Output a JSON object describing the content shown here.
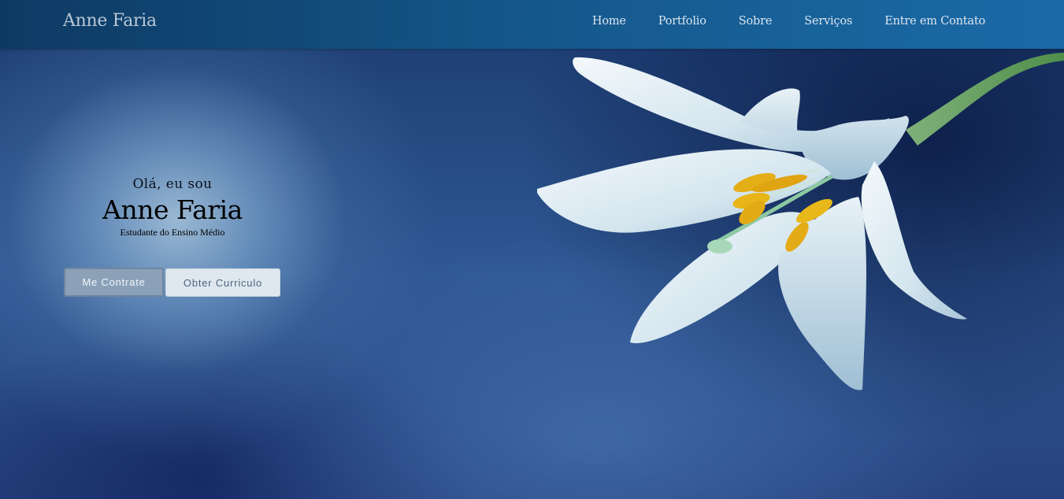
{
  "navbar": {
    "brand": "Anne Faria",
    "links": [
      {
        "label": "Home"
      },
      {
        "label": "Portfolio"
      },
      {
        "label": "Sobre"
      },
      {
        "label": "Serviços"
      },
      {
        "label": "Entre em Contato"
      }
    ]
  },
  "hero": {
    "greeting": "Olá, eu sou",
    "name": "Anne Faria",
    "subtitle": "Estudante do Ensino Médio",
    "primary_button": "Me Contrate",
    "secondary_button": "Obter Curriculo",
    "background_image": "white-lily-flower"
  },
  "colors": {
    "navbar_start": "#0d3a63",
    "navbar_end": "#1b6aa7",
    "primary_button_bg": "#8aa1b8",
    "secondary_button_bg": "#dfe7ef"
  }
}
